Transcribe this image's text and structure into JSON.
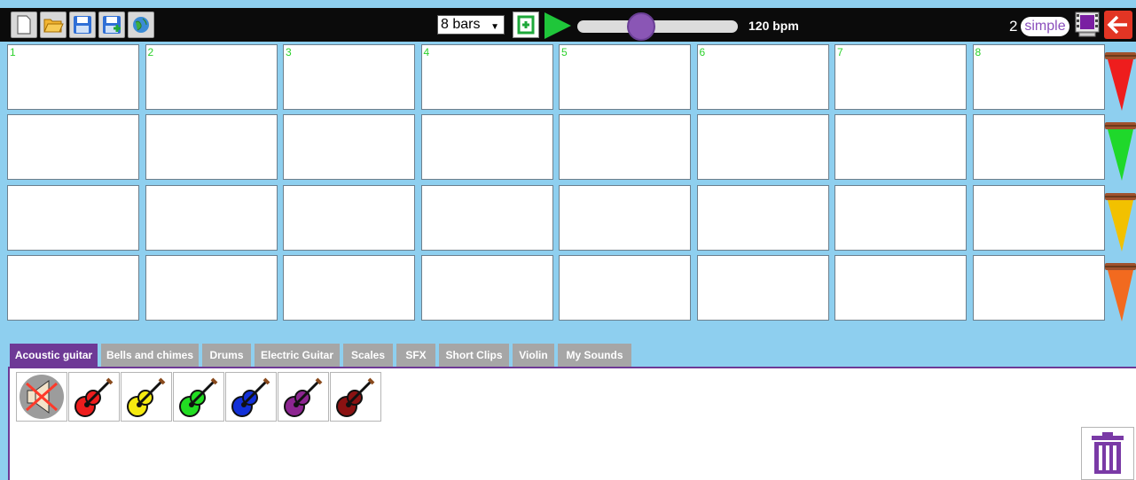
{
  "toolbar": {
    "file_buttons": [
      {
        "name": "new-file-icon",
        "color": "#ffffff"
      },
      {
        "name": "open-folder-icon",
        "color": "#f2b533"
      },
      {
        "name": "save-disk-icon",
        "color": "#2f6fd6"
      },
      {
        "name": "save-as-disk-icon",
        "color": "#2f6fd6"
      },
      {
        "name": "globe-icon",
        "color": "#3a8bd6"
      }
    ],
    "bars_select": "8 bars",
    "loop_icon": "loop-icon",
    "play_icon": "play-icon",
    "tempo_value": 120,
    "tempo_min": 40,
    "tempo_max": 240,
    "bpm_label": "120 bpm",
    "mode_number": "2",
    "mode_label": "simple",
    "film_icon": "film-icon",
    "back_icon": "back-arrow-icon"
  },
  "grid": {
    "bar_numbers": [
      "1",
      "2",
      "3",
      "4",
      "5",
      "6",
      "7",
      "8"
    ],
    "rows": 4
  },
  "track_colors": [
    "#ee1d1d",
    "#1fd82b",
    "#f2c100",
    "#f26a1f"
  ],
  "tabs": [
    {
      "label": "Acoustic guitar",
      "active": true
    },
    {
      "label": "Bells and chimes",
      "active": false
    },
    {
      "label": "Drums",
      "active": false
    },
    {
      "label": "Electric Guitar",
      "active": false
    },
    {
      "label": "Scales",
      "active": false
    },
    {
      "label": "SFX",
      "active": false
    },
    {
      "label": "Short Clips",
      "active": false
    },
    {
      "label": "Violin",
      "active": false
    },
    {
      "label": "My Sounds",
      "active": false
    }
  ],
  "sounds": [
    {
      "icon": "mute-speaker-icon",
      "color": "#888888"
    },
    {
      "icon": "guitar-icon",
      "color": "#ee1d1d"
    },
    {
      "icon": "guitar-icon",
      "color": "#f5ea10"
    },
    {
      "icon": "guitar-icon",
      "color": "#22dd22"
    },
    {
      "icon": "guitar-icon",
      "color": "#1230d8"
    },
    {
      "icon": "guitar-icon",
      "color": "#8d2591"
    },
    {
      "icon": "guitar-icon",
      "color": "#8b1212"
    }
  ],
  "trash_icon": "trash-icon",
  "accent": "#6e3996"
}
